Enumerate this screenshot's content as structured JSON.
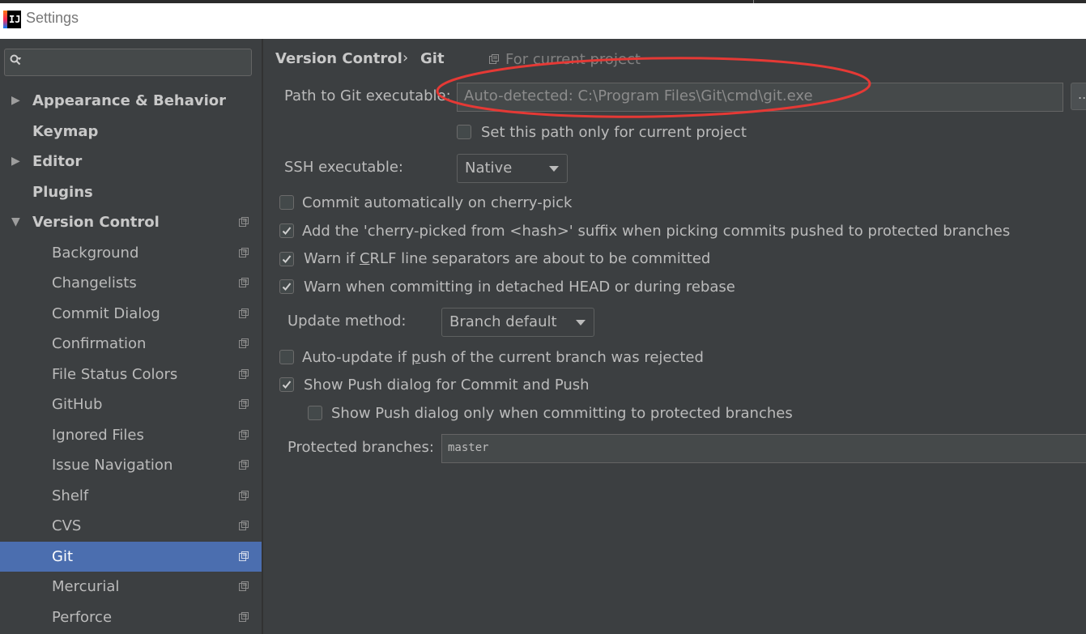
{
  "window": {
    "title": "Settings",
    "app_icon_text": "IJ"
  },
  "search": {
    "value": "",
    "placeholder": ""
  },
  "sidebar": {
    "items": [
      {
        "label": "Appearance & Behavior",
        "level": 0,
        "expandable": true,
        "expanded": false
      },
      {
        "label": "Keymap",
        "level": 0,
        "expandable": false
      },
      {
        "label": "Editor",
        "level": 0,
        "expandable": true,
        "expanded": false
      },
      {
        "label": "Plugins",
        "level": 0,
        "expandable": false
      },
      {
        "label": "Version Control",
        "level": 0,
        "expandable": true,
        "expanded": true,
        "project_icon": true
      },
      {
        "label": "Background",
        "level": 1,
        "project_icon": true
      },
      {
        "label": "Changelists",
        "level": 1,
        "project_icon": true
      },
      {
        "label": "Commit Dialog",
        "level": 1,
        "project_icon": true
      },
      {
        "label": "Confirmation",
        "level": 1,
        "project_icon": true
      },
      {
        "label": "File Status Colors",
        "level": 1,
        "project_icon": true
      },
      {
        "label": "GitHub",
        "level": 1,
        "project_icon": true
      },
      {
        "label": "Ignored Files",
        "level": 1,
        "project_icon": true
      },
      {
        "label": "Issue Navigation",
        "level": 1,
        "project_icon": true
      },
      {
        "label": "Shelf",
        "level": 1,
        "project_icon": true
      },
      {
        "label": "CVS",
        "level": 1,
        "project_icon": true
      },
      {
        "label": "Git",
        "level": 1,
        "project_icon": true,
        "selected": true
      },
      {
        "label": "Mercurial",
        "level": 1,
        "project_icon": true
      },
      {
        "label": "Perforce",
        "level": 1,
        "project_icon": true
      }
    ]
  },
  "breadcrumb": {
    "parent": "Version Control",
    "separator": "›",
    "current": "Git",
    "scope": "For current project"
  },
  "git": {
    "path_label": "Path to Git executable:",
    "path_value": "Auto-detected: C:\\Program Files\\Git\\cmd\\git.exe",
    "browse_label": "...",
    "set_path_only_label": "Set this path only for current project",
    "set_path_only_checked": false,
    "ssh_label": "SSH executable:",
    "ssh_value": "Native",
    "commit_cherry_pick_label": "Commit automatically on cherry-pick",
    "commit_cherry_pick_checked": false,
    "cherry_suffix_label": "Add the 'cherry-picked from <hash>' suffix when picking commits pushed to protected branches",
    "cherry_suffix_checked": true,
    "crlf_label_pre": "Warn if ",
    "crlf_label_mnemonic": "C",
    "crlf_label_post": "RLF line separators are about to be committed",
    "crlf_checked": true,
    "detached_label": "Warn when committing in detached HEAD or during rebase",
    "detached_checked": true,
    "update_method_label": "Update method:",
    "update_method_value": "Branch default",
    "auto_update_label_pre": "Auto-update if ",
    "auto_update_label_mnemonic": "p",
    "auto_update_label_post": "ush of the current branch was rejected",
    "auto_update_checked": false,
    "show_push_label": "Show Push dialog for Commit and Push",
    "show_push_checked": true,
    "show_push_protected_label": "Show Push dialog only when committing to protected branches",
    "show_push_protected_checked": false,
    "protected_branches_label": "Protected branches:",
    "protected_branches_value": "master"
  },
  "colors": {
    "background": "#3c3f41",
    "selection": "#4b6eaf",
    "annotation": "#e53935"
  }
}
